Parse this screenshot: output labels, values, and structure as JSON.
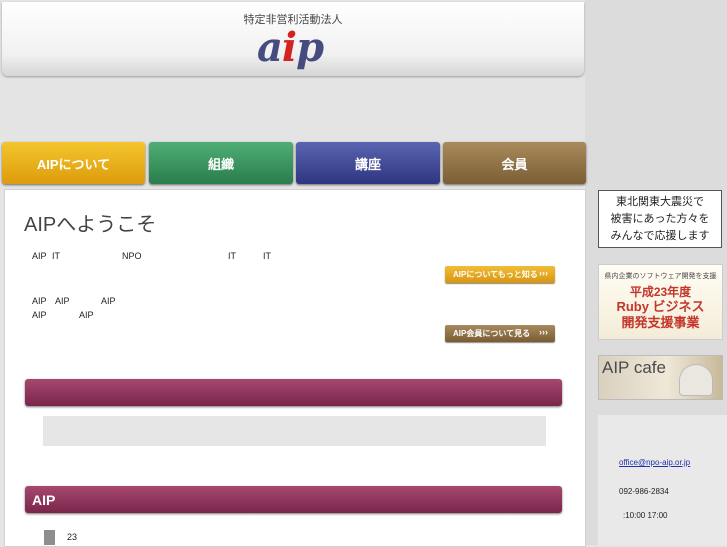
{
  "header": {
    "org_type": "特定非営利活動法人",
    "logo_text_a": "a",
    "logo_text_i": "i",
    "logo_text_p": "p"
  },
  "nav": [
    "AIPについて",
    "組織",
    "講座",
    "会員"
  ],
  "main": {
    "welcome_title": "AIPへようこそ",
    "intro_fragments": [
      "AIP",
      "IT",
      "NPO",
      "IT",
      "IT"
    ],
    "member_fragments_1": [
      "AIP",
      "AIP",
      "AIP"
    ],
    "member_fragments_2": [
      "AIP",
      "AIP"
    ],
    "more_about_button": "AIPについてもっと知る",
    "member_button": "AIP会員について見る",
    "section_title": "AIP",
    "news_date": "23"
  },
  "sidebar": {
    "quake_banner": [
      "東北関東大震災で",
      "被害にあった方々を",
      "みんなで応援します"
    ],
    "ruby_banner": {
      "caption": "県内企業のソフトウェア開発を支援",
      "line1": "平成23年度",
      "line2": "Ruby ビジネス",
      "line3": "開発支援事業"
    },
    "cafe_banner": "AIP cafe",
    "contact": {
      "email": "office@npo-aip.or.jp",
      "tel": "092-986-2834",
      "hours": ":10:00 17:00"
    }
  },
  "colors": {
    "nav_about": "#e3a81b",
    "nav_org": "#3a9560",
    "nav_course": "#414a98",
    "nav_member": "#8f7047",
    "section_bar": "#8e3358",
    "logo": "#474c80"
  }
}
